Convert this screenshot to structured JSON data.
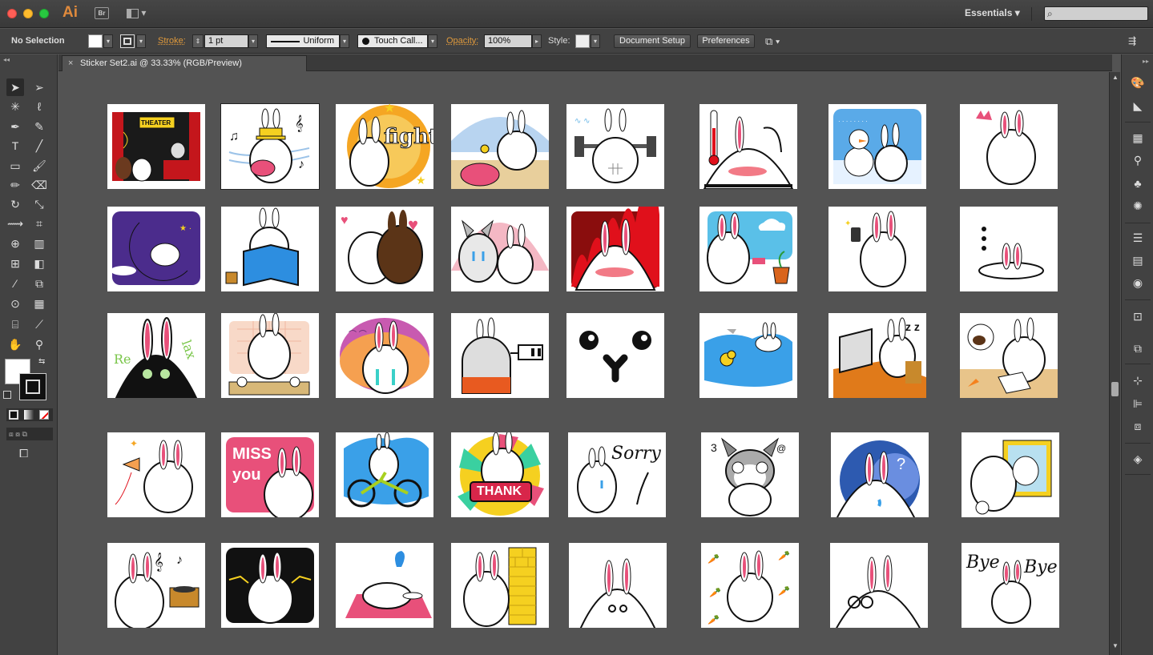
{
  "app": {
    "logo": "Ai",
    "bridge": "Br",
    "workspace": "Essentials"
  },
  "control": {
    "selection": "No Selection",
    "stroke_label": "Stroke:",
    "stroke_weight": "1 pt",
    "profile": "Uniform",
    "brush": "Touch Call...",
    "opacity_label": "Opacity:",
    "opacity": "100%",
    "style_label": "Style:",
    "doc_setup": "Document Setup",
    "preferences": "Preferences"
  },
  "document": {
    "tab_title": "Sticker Set2.ai @ 33.33% (RGB/Preview)"
  },
  "stickers": {
    "theater_sign": "THEATER",
    "fight": "fight",
    "relax_1": "Re",
    "relax_2": "lax",
    "miss_1": "MISS",
    "miss_2": "you",
    "thank": "THANK",
    "sorry": "Sorry",
    "bye_1": "Bye",
    "bye_2": "Bye"
  },
  "colors": {
    "ui_bg": "#535353",
    "panel": "#424242",
    "accent": "#e09a3c",
    "bunny_pink": "#e8507a"
  }
}
